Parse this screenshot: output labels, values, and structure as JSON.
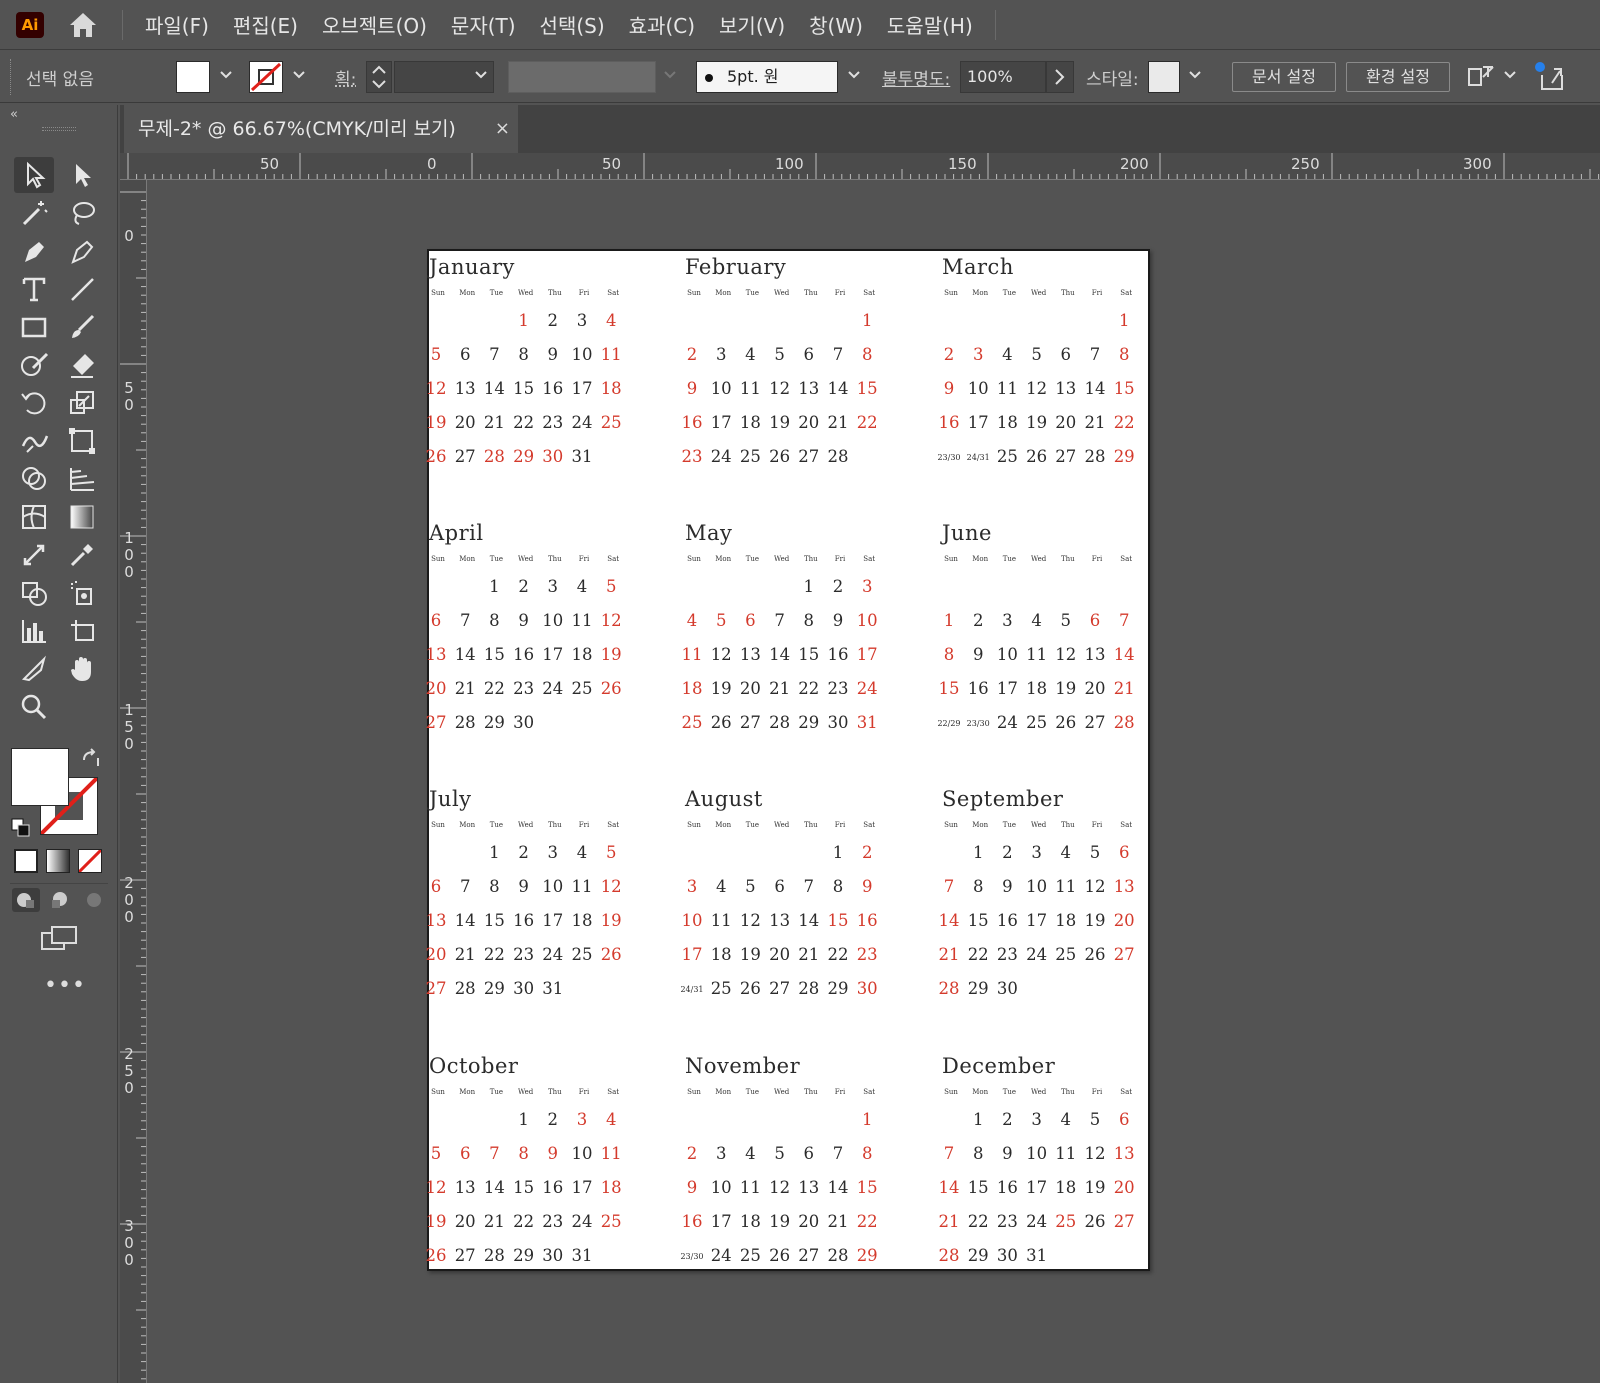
{
  "app": {
    "logo": "Ai",
    "accent": "#ff9a00"
  },
  "menu": [
    "파일(F)",
    "편집(E)",
    "오브젝트(O)",
    "문자(T)",
    "선택(S)",
    "효과(C)",
    "보기(V)",
    "창(W)",
    "도움말(H)"
  ],
  "control": {
    "selection": "선택 없음",
    "stroke_label": "획:",
    "brush": "5pt. 원",
    "opacity_label": "불투명도:",
    "opacity_value": "100%",
    "style_label": "스타일:",
    "doc_setup": "문서 설정",
    "prefs": "환경 설정"
  },
  "tab": {
    "title": "무제-2* @ 66.67%(CMYK/미리 보기)",
    "close": "×"
  },
  "ruler": {
    "h": [
      "50",
      "0",
      "50",
      "100",
      "150",
      "200",
      "250",
      "300"
    ],
    "v": [
      "0",
      "50",
      "100",
      "150",
      "200",
      "250",
      "300"
    ]
  },
  "calendar": {
    "weekdays": [
      "Sun",
      "Mon",
      "Tue",
      "Wed",
      "Thu",
      "Fri",
      "Sat"
    ],
    "holiday_color": "#d43a2c",
    "months": [
      {
        "name": "January",
        "rows": [
          [
            "",
            "",
            "",
            "1",
            "2",
            "3",
            "4"
          ],
          [
            "5",
            "6",
            "7",
            "8",
            "9",
            "10",
            "11"
          ],
          [
            "12",
            "13",
            "14",
            "15",
            "16",
            "17",
            "18"
          ],
          [
            "19",
            "20",
            "21",
            "22",
            "23",
            "24",
            "25"
          ],
          [
            "26",
            "27",
            "28",
            "29",
            "30",
            "31",
            ""
          ]
        ],
        "red": [
          "1",
          "4",
          "5",
          "11",
          "12",
          "18",
          "19",
          "25",
          "26",
          "28",
          "29",
          "30"
        ]
      },
      {
        "name": "February",
        "rows": [
          [
            "",
            "",
            "",
            "",
            "",
            "",
            "1"
          ],
          [
            "2",
            "3",
            "4",
            "5",
            "6",
            "7",
            "8"
          ],
          [
            "9",
            "10",
            "11",
            "12",
            "13",
            "14",
            "15"
          ],
          [
            "16",
            "17",
            "18",
            "19",
            "20",
            "21",
            "22"
          ],
          [
            "23",
            "24",
            "25",
            "26",
            "27",
            "28",
            ""
          ]
        ],
        "red": [
          "1",
          "2",
          "8",
          "9",
          "15",
          "16",
          "22",
          "23"
        ]
      },
      {
        "name": "March",
        "rows": [
          [
            "",
            "",
            "",
            "",
            "",
            "",
            "1"
          ],
          [
            "2",
            "3",
            "4",
            "5",
            "6",
            "7",
            "8"
          ],
          [
            "9",
            "10",
            "11",
            "12",
            "13",
            "14",
            "15"
          ],
          [
            "16",
            "17",
            "18",
            "19",
            "20",
            "21",
            "22"
          ],
          [
            "23/30",
            "24/31",
            "25",
            "26",
            "27",
            "28",
            "29"
          ]
        ],
        "red": [
          "1",
          "2",
          "3",
          "8",
          "9",
          "15",
          "16",
          "22",
          "29"
        ]
      },
      {
        "name": "April",
        "rows": [
          [
            "",
            "",
            "1",
            "2",
            "3",
            "4",
            "5"
          ],
          [
            "6",
            "7",
            "8",
            "9",
            "10",
            "11",
            "12"
          ],
          [
            "13",
            "14",
            "15",
            "16",
            "17",
            "18",
            "19"
          ],
          [
            "20",
            "21",
            "22",
            "23",
            "24",
            "25",
            "26"
          ],
          [
            "27",
            "28",
            "29",
            "30",
            "",
            "",
            ""
          ]
        ],
        "red": [
          "5",
          "6",
          "12",
          "13",
          "19",
          "20",
          "26",
          "27"
        ]
      },
      {
        "name": "May",
        "rows": [
          [
            "",
            "",
            "",
            "",
            "1",
            "2",
            "3"
          ],
          [
            "4",
            "5",
            "6",
            "7",
            "8",
            "9",
            "10"
          ],
          [
            "11",
            "12",
            "13",
            "14",
            "15",
            "16",
            "17"
          ],
          [
            "18",
            "19",
            "20",
            "21",
            "22",
            "23",
            "24"
          ],
          [
            "25",
            "26",
            "27",
            "28",
            "29",
            "30",
            "31"
          ]
        ],
        "red": [
          "3",
          "4",
          "5",
          "6",
          "10",
          "11",
          "17",
          "18",
          "24",
          "25",
          "31"
        ]
      },
      {
        "name": "June",
        "rows": [
          [
            "",
            "",
            "",
            "",
            "",
            "",
            ""
          ],
          [
            "1",
            "2",
            "3",
            "4",
            "5",
            "6",
            "7"
          ],
          [
            "8",
            "9",
            "10",
            "11",
            "12",
            "13",
            "14"
          ],
          [
            "15",
            "16",
            "17",
            "18",
            "19",
            "20",
            "21"
          ],
          [
            "22/29",
            "23/30",
            "24",
            "25",
            "26",
            "27",
            "28"
          ]
        ],
        "red": [
          "1",
          "6",
          "7",
          "8",
          "14",
          "15",
          "21",
          "28"
        ]
      },
      {
        "name": "July",
        "rows": [
          [
            "",
            "",
            "1",
            "2",
            "3",
            "4",
            "5"
          ],
          [
            "6",
            "7",
            "8",
            "9",
            "10",
            "11",
            "12"
          ],
          [
            "13",
            "14",
            "15",
            "16",
            "17",
            "18",
            "19"
          ],
          [
            "20",
            "21",
            "22",
            "23",
            "24",
            "25",
            "26"
          ],
          [
            "27",
            "28",
            "29",
            "30",
            "31",
            "",
            ""
          ]
        ],
        "red": [
          "5",
          "6",
          "12",
          "13",
          "19",
          "20",
          "26",
          "27"
        ]
      },
      {
        "name": "August",
        "rows": [
          [
            "",
            "",
            "",
            "",
            "",
            "1",
            "2"
          ],
          [
            "3",
            "4",
            "5",
            "6",
            "7",
            "8",
            "9"
          ],
          [
            "10",
            "11",
            "12",
            "13",
            "14",
            "15",
            "16"
          ],
          [
            "17",
            "18",
            "19",
            "20",
            "21",
            "22",
            "23"
          ],
          [
            "24/31",
            "25",
            "26",
            "27",
            "28",
            "29",
            "30"
          ]
        ],
        "red": [
          "2",
          "3",
          "9",
          "10",
          "15",
          "16",
          "17",
          "23",
          "30"
        ]
      },
      {
        "name": "September",
        "rows": [
          [
            "",
            "1",
            "2",
            "3",
            "4",
            "5",
            "6"
          ],
          [
            "7",
            "8",
            "9",
            "10",
            "11",
            "12",
            "13"
          ],
          [
            "14",
            "15",
            "16",
            "17",
            "18",
            "19",
            "20"
          ],
          [
            "21",
            "22",
            "23",
            "24",
            "25",
            "26",
            "27"
          ],
          [
            "28",
            "29",
            "30",
            "",
            "",
            "",
            ""
          ]
        ],
        "red": [
          "6",
          "7",
          "13",
          "14",
          "20",
          "21",
          "27",
          "28"
        ]
      },
      {
        "name": "October",
        "rows": [
          [
            "",
            "",
            "",
            "1",
            "2",
            "3",
            "4"
          ],
          [
            "5",
            "6",
            "7",
            "8",
            "9",
            "10",
            "11"
          ],
          [
            "12",
            "13",
            "14",
            "15",
            "16",
            "17",
            "18"
          ],
          [
            "19",
            "20",
            "21",
            "22",
            "23",
            "24",
            "25"
          ],
          [
            "26",
            "27",
            "28",
            "29",
            "30",
            "31",
            ""
          ]
        ],
        "red": [
          "3",
          "4",
          "5",
          "6",
          "7",
          "8",
          "9",
          "11",
          "12",
          "18",
          "19",
          "25",
          "26"
        ]
      },
      {
        "name": "November",
        "rows": [
          [
            "",
            "",
            "",
            "",
            "",
            "",
            "1"
          ],
          [
            "2",
            "3",
            "4",
            "5",
            "6",
            "7",
            "8"
          ],
          [
            "9",
            "10",
            "11",
            "12",
            "13",
            "14",
            "15"
          ],
          [
            "16",
            "17",
            "18",
            "19",
            "20",
            "21",
            "22"
          ],
          [
            "23/30",
            "24",
            "25",
            "26",
            "27",
            "28",
            "29"
          ]
        ],
        "red": [
          "1",
          "2",
          "8",
          "9",
          "15",
          "16",
          "22",
          "29"
        ]
      },
      {
        "name": "December",
        "rows": [
          [
            "",
            "1",
            "2",
            "3",
            "4",
            "5",
            "6"
          ],
          [
            "7",
            "8",
            "9",
            "10",
            "11",
            "12",
            "13"
          ],
          [
            "14",
            "15",
            "16",
            "17",
            "18",
            "19",
            "20"
          ],
          [
            "21",
            "22",
            "23",
            "24",
            "25",
            "26",
            "27"
          ],
          [
            "28",
            "29",
            "30",
            "31",
            "",
            "",
            ""
          ]
        ],
        "red": [
          "6",
          "7",
          "13",
          "14",
          "20",
          "21",
          "25",
          "27",
          "28"
        ]
      }
    ]
  }
}
